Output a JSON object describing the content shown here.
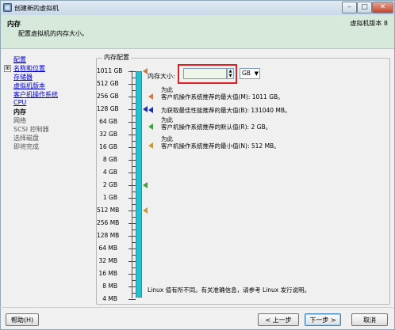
{
  "window": {
    "title": "创建新的虚拟机",
    "controls": [
      "minimize",
      "maximize",
      "close"
    ]
  },
  "header": {
    "title": "内存",
    "subtitle": "配置虚拟机的内存大小。",
    "right_text": "虚拟机版本 8"
  },
  "sidebar": {
    "items": [
      {
        "label": "配置",
        "state": "link"
      },
      {
        "label": "名称和位置",
        "state": "link"
      },
      {
        "label": "存储器",
        "state": "link"
      },
      {
        "label": "虚拟机版本",
        "state": "link"
      },
      {
        "label": "客户机操作系统",
        "state": "link"
      },
      {
        "label": "CPU",
        "state": "link"
      },
      {
        "label": "内存",
        "state": "current"
      },
      {
        "label": "网络",
        "state": "disabled"
      },
      {
        "label": "SCSI 控制器",
        "state": "disabled"
      },
      {
        "label": "选择磁盘",
        "state": "disabled"
      },
      {
        "label": "即将完成",
        "state": "disabled"
      }
    ],
    "expander": "⊞"
  },
  "memory": {
    "group_label": "内存配置",
    "scale_labels": [
      "1011 GB",
      "512 GB",
      "256 GB",
      "128 GB",
      "64 GB",
      "32 GB",
      "16 GB",
      "8 GB",
      "4 GB",
      "2 GB",
      "1 GB",
      "512 MB",
      "256 MB",
      "128 MB",
      "64 MB",
      "32 MB",
      "16 MB",
      "8 MB",
      "4 MB"
    ],
    "size_label": "内存大小:",
    "size_value": "",
    "unit": "GB",
    "marker_colors": {
      "max": "#d07840",
      "best": "#1a2fb0",
      "default": "#3aa43a",
      "min": "#c89a3a"
    },
    "info": [
      {
        "prefix": "为此",
        "text": "客户机操作系统推荐的最大值(M): 1011 GB。",
        "marker": "max"
      },
      {
        "prefix": "",
        "text": "为获取最佳性能推荐的最大值(B): 131040 MB。",
        "marker": "best"
      },
      {
        "prefix": "为此",
        "text": "客户机操作系统推荐的默认值(R): 2 GB。",
        "marker": "default"
      },
      {
        "prefix": "为此",
        "text": "客户机操作系统推荐的最小值(N): 512 MB。",
        "marker": "min"
      }
    ],
    "footer": "Linux 值有所不同。有关准确信息，请参考 Linux 发行说明。"
  },
  "buttons": {
    "help": "帮助(H)",
    "back": "< 上一步",
    "next": "下一步 >",
    "cancel": "取消"
  }
}
